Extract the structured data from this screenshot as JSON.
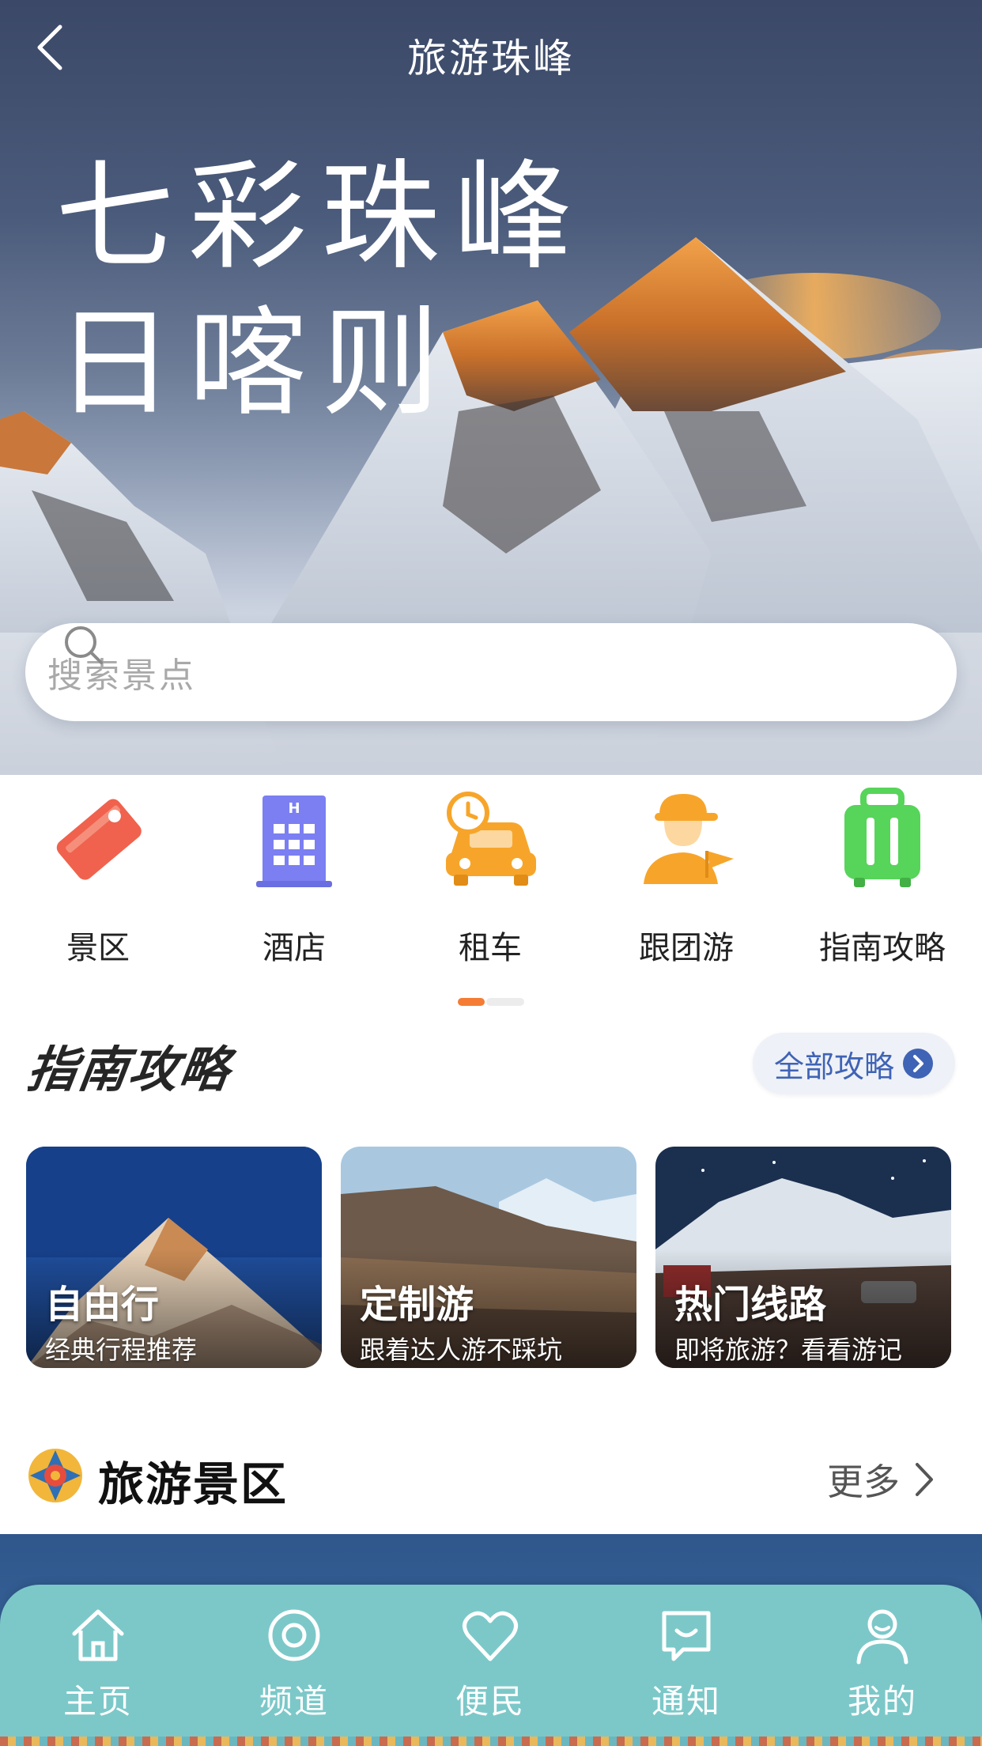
{
  "header": {
    "title": "旅游珠峰",
    "back_icon": "chevron-left-icon"
  },
  "hero": {
    "line1": "七彩珠峰",
    "line2": "日喀则"
  },
  "search": {
    "placeholder": "搜索景点",
    "icon": "search-icon"
  },
  "quick_links": [
    {
      "label": "景区",
      "icon": "tag-icon",
      "color": "#f0624d"
    },
    {
      "label": "酒店",
      "icon": "hotel-icon",
      "color": "#7b7ff2"
    },
    {
      "label": "租车",
      "icon": "car-clock-icon",
      "color": "#f7a52a"
    },
    {
      "label": "跟团游",
      "icon": "tour-guide-icon",
      "color": "#f7a52a"
    },
    {
      "label": "指南攻略",
      "icon": "suitcase-icon",
      "color": "#57d45a"
    }
  ],
  "pager": {
    "active_index": 0,
    "count": 2,
    "active_color": "#f47c35"
  },
  "guide": {
    "title": "指南攻略",
    "all_label": "全部攻略",
    "cards": [
      {
        "title": "自由行",
        "subtitle": "经典行程推荐"
      },
      {
        "title": "定制游",
        "subtitle": "跟着达人游不踩坑"
      },
      {
        "title": "热门线路",
        "subtitle": "即将旅游？看看游记"
      }
    ]
  },
  "scenic": {
    "title": "旅游景区",
    "more_label": "更多",
    "icon": "mandala-icon"
  },
  "tabbar": {
    "background": "#7cc8c9",
    "items": [
      {
        "label": "主页",
        "icon": "home-icon"
      },
      {
        "label": "频道",
        "icon": "channel-icon"
      },
      {
        "label": "便民",
        "icon": "heart-icon"
      },
      {
        "label": "通知",
        "icon": "message-icon"
      },
      {
        "label": "我的",
        "icon": "user-icon"
      }
    ]
  }
}
